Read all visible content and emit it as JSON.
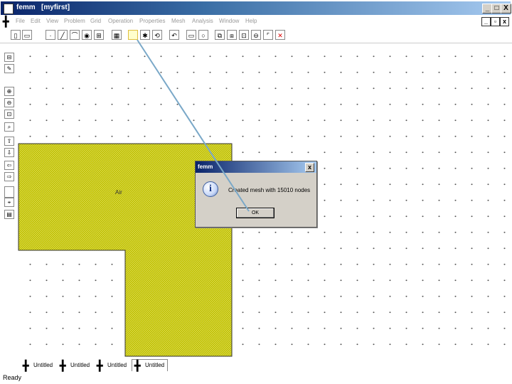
{
  "window": {
    "app": "femm",
    "document": "[myfirst]",
    "minimize": "_",
    "maximize": "□",
    "close": "X"
  },
  "menu": {
    "items": [
      "File",
      "Edit",
      "View",
      "Problem",
      "Grid",
      "Operation",
      "Properties",
      "Mesh",
      "Analysis",
      "Window",
      "Help"
    ],
    "mdi_minimize": "_",
    "mdi_restore": "▫",
    "mdi_close": "x"
  },
  "toolbar": {
    "icons": [
      "new-icon",
      "open-icon",
      "node-icon",
      "segment-icon",
      "arc-icon",
      "block-label-icon",
      "group-icon",
      "mesh-icon",
      "run-analysis-icon",
      "view-results-icon",
      "undo-icon",
      "select-rect-icon",
      "select-circle-icon",
      "copy-icon",
      "move-icon",
      "scale-icon",
      "mirror-icon",
      "fillet-icon",
      "delete-icon"
    ]
  },
  "sidebar": {
    "icons": [
      "zoom-extents-icon",
      "edit-icon",
      "zoom-in-icon",
      "zoom-out-icon",
      "zoom-window-icon",
      "zoom-natural-icon",
      "pan-up-icon",
      "pan-down-icon",
      "pan-left-icon",
      "pan-right-icon",
      "snap-grid-icon",
      "grid-icon"
    ]
  },
  "canvas": {
    "block_label": "Air",
    "fill_color": "#c8c800"
  },
  "dialog": {
    "title": "femm",
    "close": "x",
    "message": "Created mesh with 15010 nodes",
    "ok": "OK"
  },
  "tabs": [
    "Untitled",
    "Untitled",
    "Untitled",
    "Untitled"
  ],
  "status": "Ready"
}
